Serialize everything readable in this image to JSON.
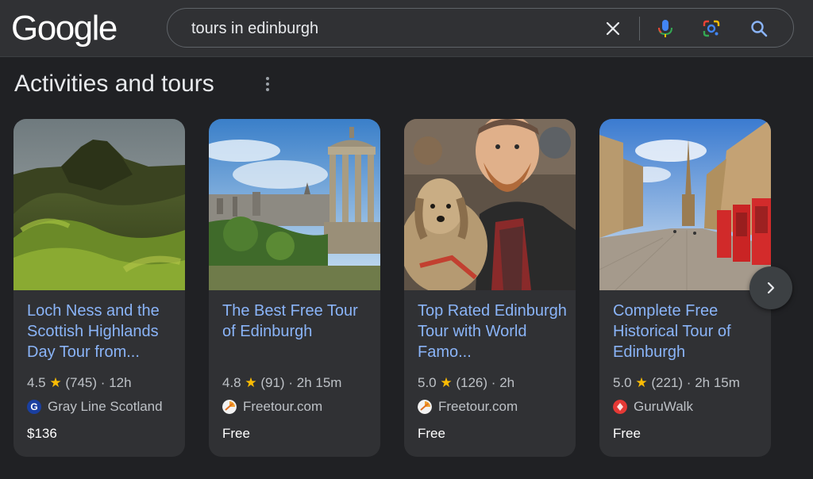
{
  "header": {
    "logo_text": "Google",
    "search_query": "tours in edinburgh"
  },
  "section": {
    "title": "Activities and tours"
  },
  "cards": [
    {
      "title": "Loch Ness and the Scottish Highlands Day Tour from...",
      "rating": "4.5",
      "reviews": "(745)",
      "duration": "12h",
      "provider": "Gray Line Scotland",
      "provider_logo_letter": "G",
      "price": "$136"
    },
    {
      "title": "The Best Free Tour of Edinburgh",
      "rating": "4.8",
      "reviews": "(91)",
      "duration": "2h 15m",
      "provider": "Freetour.com",
      "provider_logo_letter": "",
      "price": "Free"
    },
    {
      "title": "Top Rated Edinburgh Tour with World Famo...",
      "rating": "5.0",
      "reviews": "(126)",
      "duration": "2h",
      "provider": "Freetour.com",
      "provider_logo_letter": "",
      "price": "Free"
    },
    {
      "title": "Complete Free Historical Tour of Edinburgh",
      "rating": "5.0",
      "reviews": "(221)",
      "duration": "2h 15m",
      "provider": "GuruWalk",
      "provider_logo_letter": "",
      "price": "Free"
    }
  ],
  "icons": {
    "clear": "close-icon",
    "voice": "microphone-icon",
    "lens": "google-lens-icon",
    "search": "search-icon",
    "more": "more-vert-icon",
    "next": "chevron-right-icon"
  },
  "colors": {
    "background": "#202124",
    "card": "#303134",
    "link": "#8ab4f8",
    "star": "#fbbc04"
  }
}
